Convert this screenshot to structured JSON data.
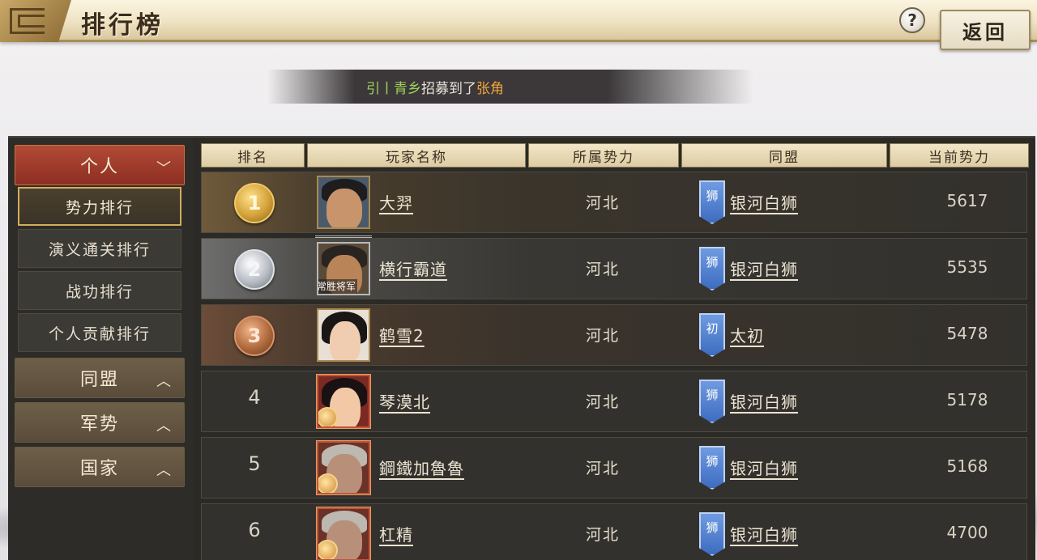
{
  "header": {
    "title": "排行榜",
    "help_label": "?",
    "back_label": "返回"
  },
  "marquee": {
    "prefix": "引丨青乡",
    "middle": "招募到了",
    "name": "张角"
  },
  "sidebar": {
    "personal": {
      "label": "个人",
      "chevron": "﹀"
    },
    "sub_items": [
      {
        "label": "势力排行",
        "active": true
      },
      {
        "label": "演义通关排行",
        "active": false
      },
      {
        "label": "战功排行",
        "active": false
      },
      {
        "label": "个人贡献排行",
        "active": false
      }
    ],
    "alliance": {
      "label": "同盟",
      "chevron": "︿"
    },
    "military": {
      "label": "军势",
      "chevron": "︿"
    },
    "nation": {
      "label": "国家",
      "chevron": "︿"
    }
  },
  "table": {
    "headers": {
      "rank": "排名",
      "player": "玩家名称",
      "faction": "所属势力",
      "alliance": "同盟",
      "power": "当前势力"
    },
    "rows": [
      {
        "rank": "1",
        "name": "大羿",
        "faction": "河北",
        "banner": "狮",
        "alliance": "银河白狮",
        "power": "5617"
      },
      {
        "rank": "2",
        "name": "横行霸道",
        "faction": "河北",
        "banner": "狮",
        "alliance": "银河白狮",
        "power": "5535",
        "avatar_tag": "常胜将军"
      },
      {
        "rank": "3",
        "name": "鹤雪2",
        "faction": "河北",
        "banner": "初",
        "alliance": "太初",
        "power": "5478"
      },
      {
        "rank": "4",
        "name": "琴漠北",
        "faction": "河北",
        "banner": "狮",
        "alliance": "银河白狮",
        "power": "5178"
      },
      {
        "rank": "5",
        "name": "鋼鐵加魯魯",
        "faction": "河北",
        "banner": "狮",
        "alliance": "银河白狮",
        "power": "5168"
      },
      {
        "rank": "6",
        "name": "杠精",
        "faction": "河北",
        "banner": "狮",
        "alliance": "银河白狮",
        "power": "4700"
      }
    ]
  },
  "colors": {
    "accent_red": "#9e3a2a",
    "gold": "#d4ad5c",
    "banner_blue": "#4f7fd0",
    "marquee_green": "#9fd35a",
    "marquee_orange": "#f2a53a"
  }
}
